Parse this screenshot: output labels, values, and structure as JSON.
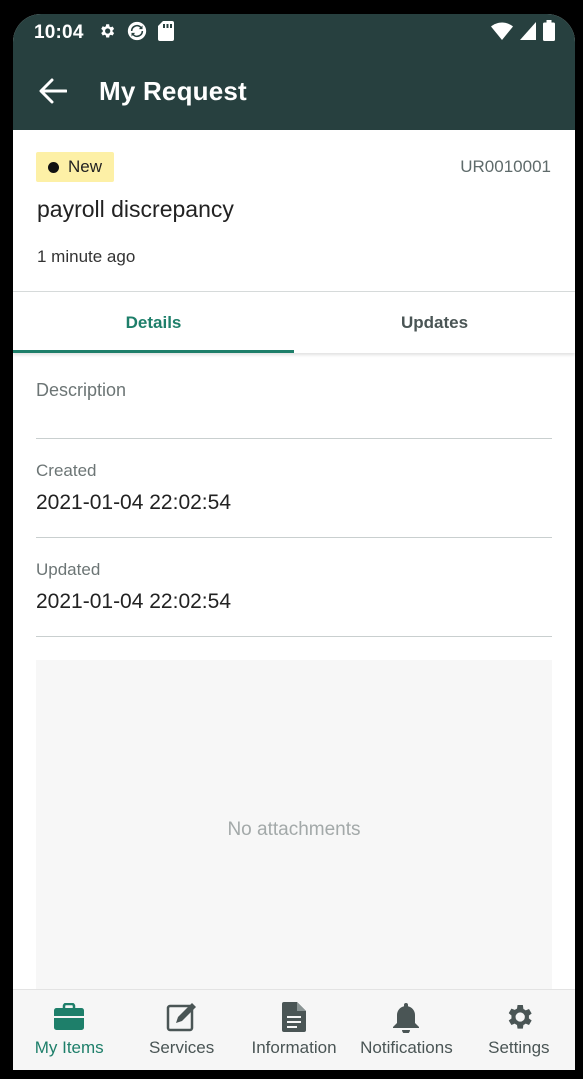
{
  "status_bar": {
    "time": "10:04"
  },
  "app_bar": {
    "title": "My Request"
  },
  "request": {
    "status": "New",
    "id": "UR0010001",
    "title": "payroll discrepancy",
    "age": "1 minute ago"
  },
  "tabs": [
    {
      "label": "Details",
      "active": true
    },
    {
      "label": "Updates",
      "active": false
    }
  ],
  "details": {
    "description_label": "Description",
    "created_label": "Created",
    "created_value": "2021-01-04 22:02:54",
    "updated_label": "Updated",
    "updated_value": "2021-01-04 22:02:54",
    "attachments_empty": "No attachments"
  },
  "bottom_nav": [
    {
      "label": "My Items",
      "icon": "briefcase-icon",
      "active": true
    },
    {
      "label": "Services",
      "icon": "edit-icon",
      "active": false
    },
    {
      "label": "Information",
      "icon": "document-icon",
      "active": false
    },
    {
      "label": "Notifications",
      "icon": "bell-icon",
      "active": false
    },
    {
      "label": "Settings",
      "icon": "gear-icon",
      "active": false
    }
  ],
  "colors": {
    "app_bar": "#27403f",
    "accent": "#1e7f6a",
    "status_chip": "#fdf0a6"
  }
}
